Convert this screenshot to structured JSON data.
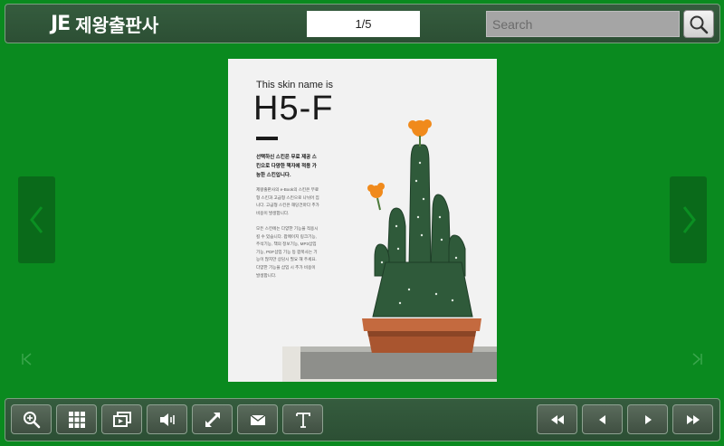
{
  "header": {
    "logo_mark": "JE",
    "logo_text": "제왕출판사",
    "page_indicator": "1/5",
    "search": {
      "placeholder": "Search",
      "value": ""
    }
  },
  "page": {
    "small_title": "This skin name is",
    "big_title": "H5-F",
    "lead_text": "선택하신 스킨은 무료 제공 스킨으로 다양한 책자에 적용 가능한 스킨입니다.",
    "body_text_1": "제왕출판사의 e-Book의 스킨은 무료형 스킨과 고급형 스킨으로 나뉘어 집니다. 고급형 스킨은 해당건마다 추가비용이 발생합니다.",
    "body_text_2": "모든 스킨에는 다양한 기능을 적용시킬 수 있습니다. 팝메이지 링크기능, 주석기능, 책의 정보기능, MP3삽입 기능, PDF삽입 기능 등 팝북사는 기능이 많지만 상담시 필요 해 주세요. 다양한 기능을 삽입 시 추가 비용이 발생합니다."
  },
  "toolbar": {
    "left_buttons": [
      "zoom-in",
      "thumbnails",
      "slideshow",
      "sound",
      "fullscreen",
      "email",
      "text"
    ],
    "right_buttons": [
      "first-page",
      "previous-page",
      "next-page",
      "last-page"
    ]
  },
  "colors": {
    "background": "#0a8a1f",
    "bar": "#2f5236",
    "side_arrow": "#0a6a1a"
  }
}
